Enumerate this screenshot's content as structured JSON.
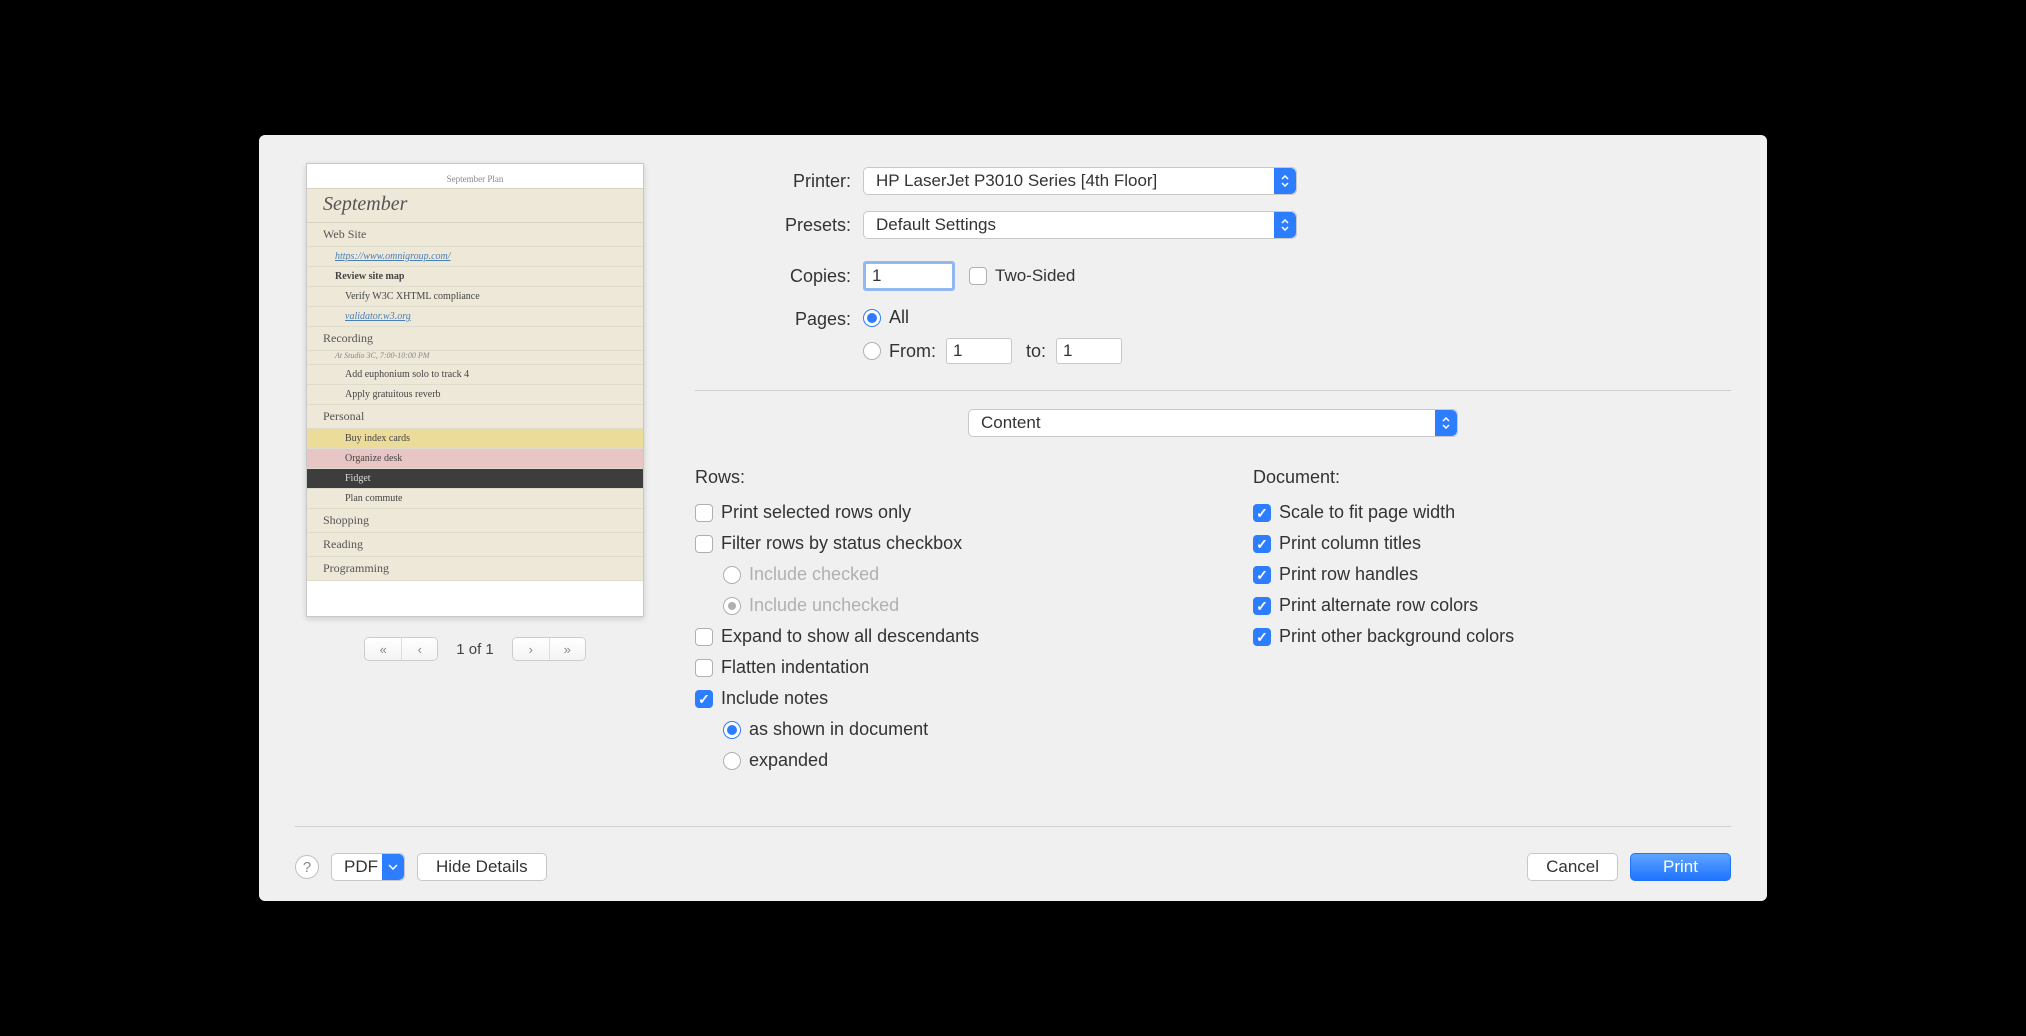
{
  "preview": {
    "doc_title": "September Plan",
    "heading": "September",
    "rows": [
      {
        "text": "Web Site",
        "cls": "sec"
      },
      {
        "text": "https://www.omnigroup.com/",
        "cls": "link"
      },
      {
        "text": "Review site map",
        "cls": "bold"
      },
      {
        "text": "Verify W3C XHTML compliance",
        "cls": "ind2"
      },
      {
        "text": "validator.w3.org",
        "cls": "ind2 link"
      },
      {
        "text": "Recording",
        "cls": "sec"
      },
      {
        "text": "At Studio 3C, 7:00-10:00 PM",
        "cls": "note"
      },
      {
        "text": "Add euphonium solo to track 4",
        "cls": "ind2"
      },
      {
        "text": "Apply gratuitous reverb",
        "cls": "ind2"
      },
      {
        "text": "Personal",
        "cls": "sec"
      },
      {
        "text": "Buy index cards",
        "cls": "ind2 yellow"
      },
      {
        "text": "Organize desk",
        "cls": "ind2 pink"
      },
      {
        "text": "Fidget",
        "cls": "ind2 dark"
      },
      {
        "text": "Plan commute",
        "cls": "ind2"
      },
      {
        "text": "Shopping",
        "cls": "sec"
      },
      {
        "text": "Reading",
        "cls": "sec"
      },
      {
        "text": "Programming",
        "cls": "sec"
      }
    ],
    "page_indicator": "1 of 1"
  },
  "labels": {
    "printer": "Printer:",
    "presets": "Presets:",
    "copies": "Copies:",
    "two_sided": "Two-Sided",
    "pages": "Pages:",
    "all": "All",
    "from": "From:",
    "to": "to:"
  },
  "values": {
    "printer": "HP LaserJet P3010 Series [4th Floor]",
    "preset": "Default Settings",
    "copies": "1",
    "from": "1",
    "to": "1",
    "section": "Content"
  },
  "rows_section": {
    "title": "Rows:",
    "print_selected": "Print selected rows only",
    "filter_status": "Filter rows by status checkbox",
    "include_checked": "Include checked",
    "include_unchecked": "Include unchecked",
    "expand_desc": "Expand to show all descendants",
    "flatten": "Flatten indentation",
    "include_notes": "Include notes",
    "notes_as_shown": "as shown in document",
    "notes_expanded": "expanded"
  },
  "doc_section": {
    "title": "Document:",
    "scale_fit": "Scale to fit page width",
    "col_titles": "Print column titles",
    "row_handles": "Print row handles",
    "alt_colors": "Print alternate row colors",
    "bg_colors": "Print other background colors"
  },
  "bottom": {
    "pdf": "PDF",
    "hide_details": "Hide Details",
    "cancel": "Cancel",
    "print": "Print"
  }
}
